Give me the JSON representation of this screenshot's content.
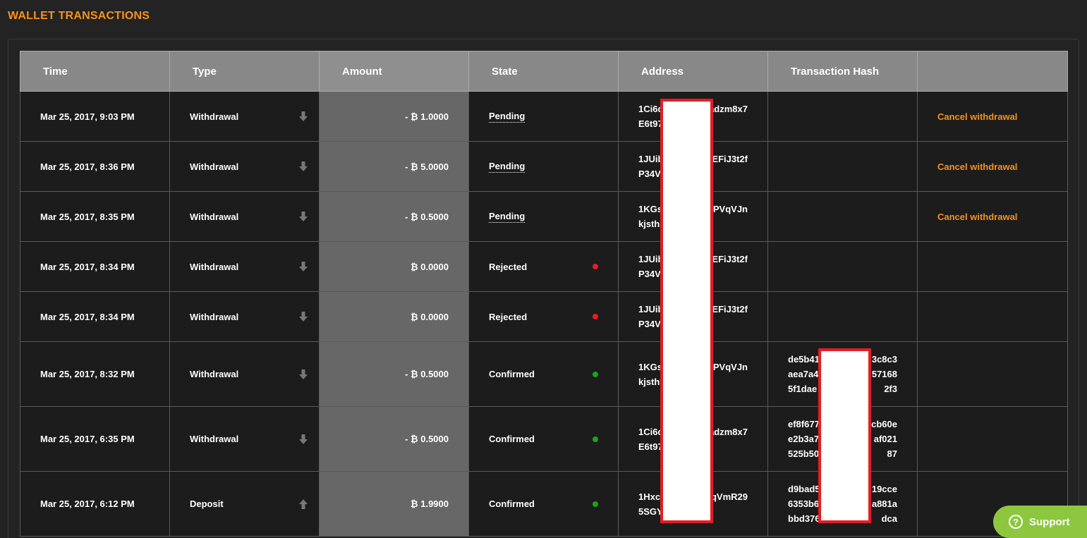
{
  "page": {
    "title": "WALLET TRANSACTIONS"
  },
  "table": {
    "headers": [
      "Time",
      "Type",
      "Amount",
      "State",
      "Address",
      "Transaction Hash",
      ""
    ],
    "rows": [
      {
        "time": "Mar 25, 2017, 9:03 PM",
        "type": "Withdrawal",
        "direction": "down-arrow-icon",
        "amount": "- ₿ 1.0000",
        "state": "Pending",
        "address": [
          "1Ci6d",
          "adzm8x7",
          "E6t97",
          ""
        ],
        "hash": [
          "",
          "",
          "",
          "",
          "",
          ""
        ],
        "action": "Cancel withdrawal"
      },
      {
        "time": "Mar 25, 2017, 8:36 PM",
        "type": "Withdrawal",
        "direction": "down-arrow-icon",
        "amount": "- ₿ 5.0000",
        "state": "Pending",
        "address": [
          "1JUib",
          "EFiJ3t2f",
          "P34V",
          ""
        ],
        "hash": [
          "",
          "",
          "",
          "",
          "",
          ""
        ],
        "action": "Cancel withdrawal"
      },
      {
        "time": "Mar 25, 2017, 8:35 PM",
        "type": "Withdrawal",
        "direction": "down-arrow-icon",
        "amount": "- ₿ 0.5000",
        "state": "Pending",
        "address": [
          "1KGs",
          "PVqVJn",
          "kjsth3",
          ""
        ],
        "hash": [
          "",
          "",
          "",
          "",
          "",
          ""
        ],
        "action": "Cancel withdrawal"
      },
      {
        "time": "Mar 25, 2017, 8:34 PM",
        "type": "Withdrawal",
        "direction": "down-arrow-icon",
        "amount": "₿ 0.0000",
        "state": "Rejected",
        "address": [
          "1JUib",
          "EFiJ3t2f",
          "P34V",
          ""
        ],
        "hash": [
          "",
          "",
          "",
          "",
          "",
          ""
        ],
        "action": ""
      },
      {
        "time": "Mar 25, 2017, 8:34 PM",
        "type": "Withdrawal",
        "direction": "down-arrow-icon",
        "amount": "₿ 0.0000",
        "state": "Rejected",
        "address": [
          "1JUib",
          "EFiJ3t2f",
          "P34V",
          ""
        ],
        "hash": [
          "",
          "",
          "",
          "",
          "",
          ""
        ],
        "action": ""
      },
      {
        "time": "Mar 25, 2017, 8:32 PM",
        "type": "Withdrawal",
        "direction": "down-arrow-icon",
        "amount": "- ₿ 0.5000",
        "state": "Confirmed",
        "address": [
          "1KGs",
          "PVqVJn",
          "kjsth3",
          ""
        ],
        "hash": [
          "de5b41",
          "3c8c3",
          "aea7a4",
          "57168",
          "5f1dae",
          "2f3"
        ],
        "action": ""
      },
      {
        "time": "Mar 25, 2017, 6:35 PM",
        "type": "Withdrawal",
        "direction": "down-arrow-icon",
        "amount": "- ₿ 0.5000",
        "state": "Confirmed",
        "address": [
          "1Ci6d",
          "adzm8x7",
          "E6t97",
          ""
        ],
        "hash": [
          "ef8f677",
          "cb60e",
          "e2b3a7",
          "af021",
          "525b50",
          "87"
        ],
        "action": ""
      },
      {
        "time": "Mar 25, 2017, 6:12 PM",
        "type": "Deposit",
        "direction": "up-arrow-icon",
        "amount": "₿ 1.9900",
        "state": "Confirmed",
        "address": [
          "1Hxc",
          "qVmR29",
          "5SGY",
          ""
        ],
        "hash": [
          "d9bad5",
          "19cce",
          "6353b6",
          "a881a",
          "bbd376",
          "dca"
        ],
        "action": ""
      }
    ]
  },
  "colors": {
    "accent": "#f7921e",
    "rejected": "#e31e25",
    "confirmed": "#1aa41a",
    "redaction_border": "#e31e25",
    "support": "#8dc63f",
    "arrow": "#777777"
  },
  "support": {
    "label": "Support",
    "icon": "question-icon"
  }
}
